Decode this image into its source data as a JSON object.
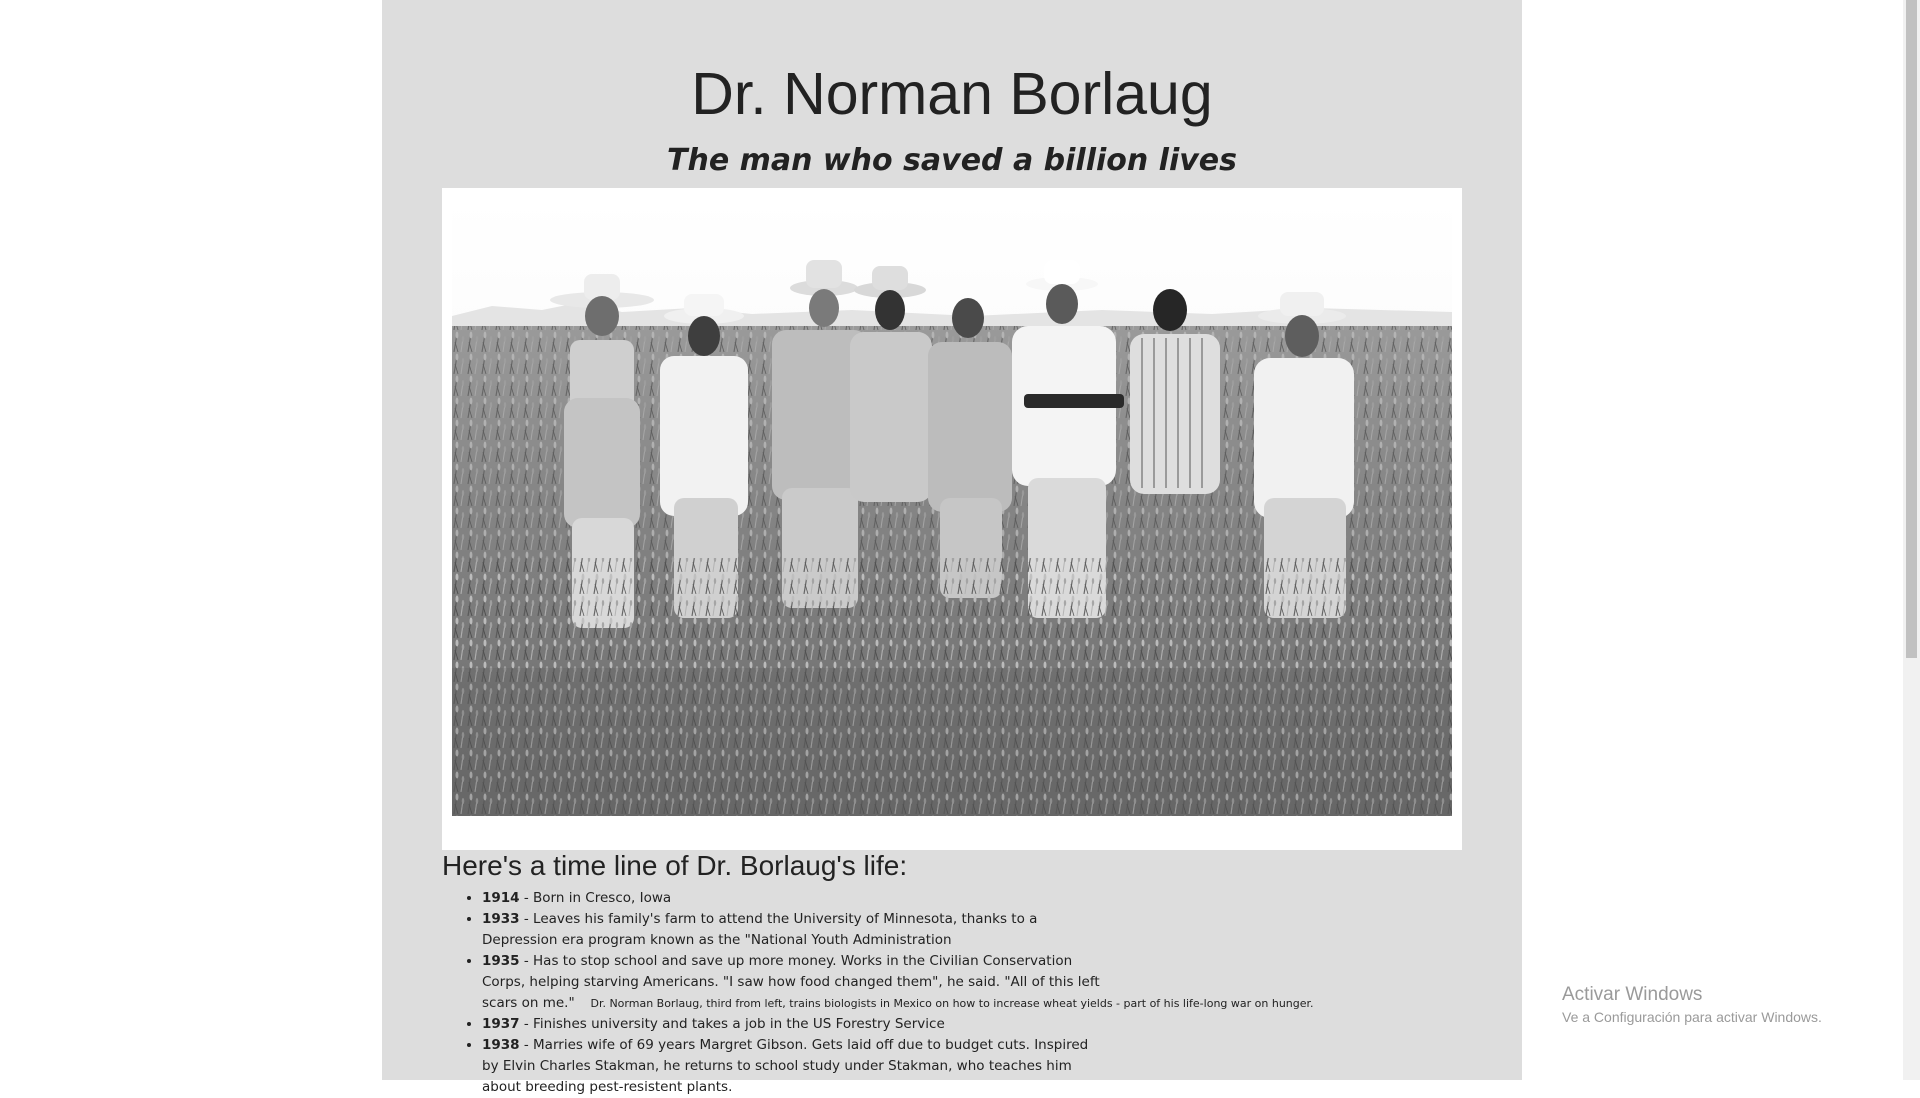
{
  "page": {
    "title": "Dr. Norman Borlaug",
    "subtitle": "The man who saved a billion lives"
  },
  "image": {
    "alt": "Dr. Norman Borlaug and biologists in a wheat field",
    "caption": "Dr. Norman Borlaug, third from left, trains biologists in Mexico on how to increase wheat yields - part of his life-long war on hunger."
  },
  "timeline": {
    "heading": "Here's a time line of Dr. Borlaug's life:",
    "items": [
      {
        "year": "1914",
        "text": " - Born in Cresco, Iowa"
      },
      {
        "year": "1933",
        "text": " - Leaves his family's farm to attend the University of Minnesota, thanks to a Depression era program known as the \"National Youth Administration"
      },
      {
        "year": "1935",
        "text": " - Has to stop school and save up more money. Works in the Civilian Conservation Corps, helping starving Americans. \"I saw how food changed them\", he said. \"All of this left scars on me.\""
      },
      {
        "year": "1937",
        "text": " - Finishes university and takes a job in the US Forestry Service"
      },
      {
        "year": "1938",
        "text": " - Marries wife of 69 years Margret Gibson. Gets laid off due to budget cuts. Inspired by Elvin Charles Stakman, he returns to school study under Stakman, who teaches him about breeding pest-resistent plants."
      }
    ]
  },
  "watermark": {
    "title": "Activar Windows",
    "subtitle": "Ve a Configuración para activar Windows."
  }
}
